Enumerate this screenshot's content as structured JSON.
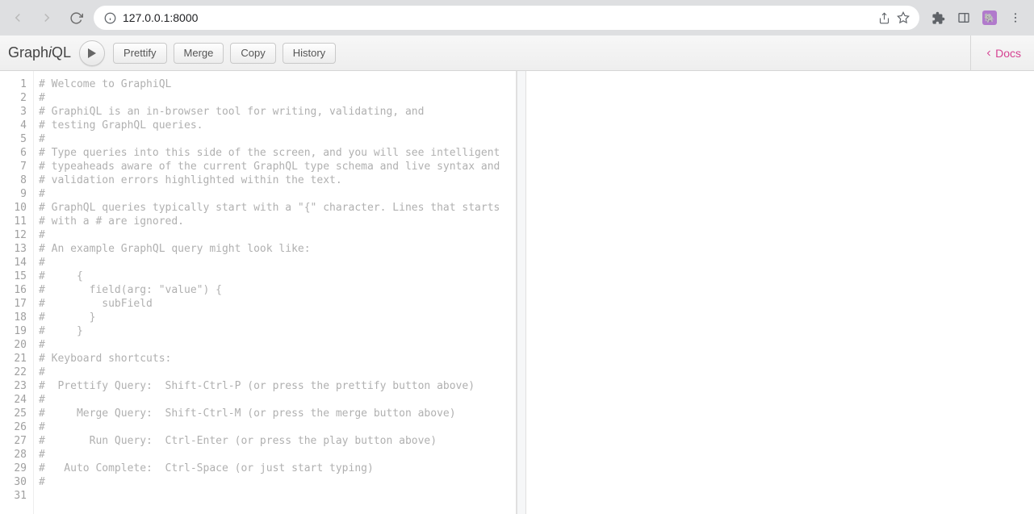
{
  "browser": {
    "url": "127.0.0.1:8000"
  },
  "toolbar": {
    "logo_graph": "Graph",
    "logo_i": "i",
    "logo_ql": "QL",
    "prettify": "Prettify",
    "merge": "Merge",
    "copy": "Copy",
    "history": "History",
    "docs": "Docs"
  },
  "editor": {
    "line_count": 31,
    "lines": [
      "# Welcome to GraphiQL",
      "#",
      "# GraphiQL is an in-browser tool for writing, validating, and",
      "# testing GraphQL queries.",
      "#",
      "# Type queries into this side of the screen, and you will see intelligent",
      "# typeaheads aware of the current GraphQL type schema and live syntax and",
      "# validation errors highlighted within the text.",
      "#",
      "# GraphQL queries typically start with a \"{\" character. Lines that starts",
      "# with a # are ignored.",
      "#",
      "# An example GraphQL query might look like:",
      "#",
      "#     {",
      "#       field(arg: \"value\") {",
      "#         subField",
      "#       }",
      "#     }",
      "#",
      "# Keyboard shortcuts:",
      "#",
      "#  Prettify Query:  Shift-Ctrl-P (or press the prettify button above)",
      "#",
      "#     Merge Query:  Shift-Ctrl-M (or press the merge button above)",
      "#",
      "#       Run Query:  Ctrl-Enter (or press the play button above)",
      "#",
      "#   Auto Complete:  Ctrl-Space (or just start typing)",
      "#",
      ""
    ]
  }
}
